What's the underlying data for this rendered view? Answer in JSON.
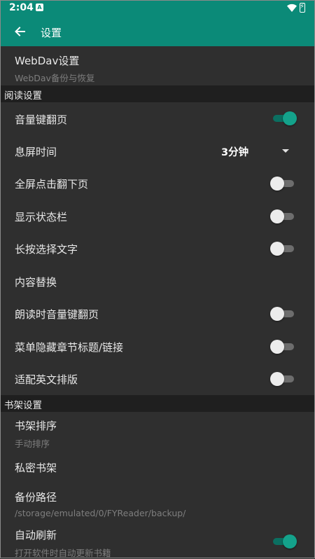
{
  "status_bar": {
    "time": "2:04",
    "notification_badge": "A"
  },
  "toolbar": {
    "title": "设置"
  },
  "webdav": {
    "title": "WebDav设置",
    "subtitle": "WebDav备份与恢复"
  },
  "reading_section": {
    "header": "阅读设置",
    "volume_key_page": {
      "label": "音量键翻页",
      "enabled": true
    },
    "screen_timeout": {
      "label": "息屏时间",
      "value": "3分钟"
    },
    "fullscreen_tap_next": {
      "label": "全屏点击翻下页",
      "enabled": false
    },
    "show_status_bar": {
      "label": "显示状态栏",
      "enabled": false
    },
    "long_press_select": {
      "label": "长按选择文字",
      "enabled": false
    },
    "content_replace": {
      "label": "内容替换"
    },
    "tts_volume_key": {
      "label": "朗读时音量键翻页",
      "enabled": false
    },
    "menu_hide_chapter": {
      "label": "菜单隐藏章节标题/链接",
      "enabled": false
    },
    "english_layout": {
      "label": "适配英文排版",
      "enabled": false
    }
  },
  "bookshelf_section": {
    "header": "书架设置",
    "sort": {
      "title": "书架排序",
      "subtitle": "手动排序"
    },
    "private_shelf": {
      "title": "私密书架"
    },
    "backup_path": {
      "title": "备份路径",
      "subtitle": "/storage/emulated/0/FYReader/backup/"
    },
    "auto_refresh": {
      "title": "自动刷新",
      "subtitle": "打开软件时自动更新书籍",
      "enabled": true
    }
  },
  "colors": {
    "accent": "#0b8a78",
    "background": "#2f2f2f",
    "section_bg": "#1f1f1f"
  },
  "icons": {
    "back": "arrow-left-icon",
    "wifi": "wifi-icon",
    "battery": "battery-icon",
    "dropdown": "caret-down-icon"
  }
}
